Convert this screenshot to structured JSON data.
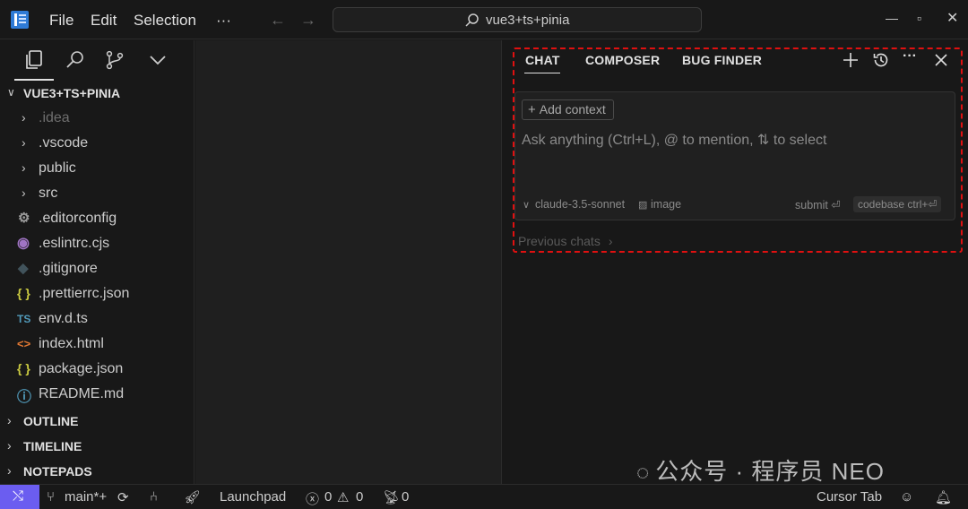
{
  "menu": {
    "file": "File",
    "edit": "Edit",
    "selection": "Selection",
    "more": "···"
  },
  "search": {
    "text": "vue3+ts+pinia"
  },
  "explorer": {
    "root": "VUE3+TS+PINIA",
    "items": [
      {
        "label": ".idea",
        "kind": "folder",
        "dim": true
      },
      {
        "label": ".vscode",
        "kind": "folder"
      },
      {
        "label": "public",
        "kind": "folder"
      },
      {
        "label": "src",
        "kind": "folder"
      },
      {
        "label": ".editorconfig",
        "kind": "gear-file"
      },
      {
        "label": ".eslintrc.cjs",
        "kind": "eslint-file"
      },
      {
        "label": ".gitignore",
        "kind": "git-file"
      },
      {
        "label": ".prettierrc.json",
        "kind": "json-file"
      },
      {
        "label": "env.d.ts",
        "kind": "ts-file"
      },
      {
        "label": "index.html",
        "kind": "html-file"
      },
      {
        "label": "package.json",
        "kind": "json-file"
      },
      {
        "label": "README.md",
        "kind": "info-file"
      }
    ],
    "sections": [
      "OUTLINE",
      "TIMELINE",
      "NOTEPADS"
    ]
  },
  "chat": {
    "tabs": [
      "CHAT",
      "COMPOSER",
      "BUG FINDER"
    ],
    "add_context": "Add context",
    "placeholder": "Ask anything (Ctrl+L), @ to mention, ⇅ to select",
    "model": "claude-3.5-sonnet",
    "image": "image",
    "submit": "submit ⏎",
    "codebase": "codebase  ctrl+⏎",
    "previous_chats": "Previous chats"
  },
  "icons": {
    "ts": "TS",
    "json": "{ }",
    "html": "<>"
  },
  "watermark": "公众号 · 程序员 NEO",
  "status": {
    "branch": "main*+",
    "launchpad": "Launchpad",
    "errors": "0",
    "warnings": "0",
    "ports": "0",
    "cursor_tab": "Cursor Tab"
  },
  "colors": {
    "accent": "#6b5df0",
    "highlight": "#e01010",
    "json_icon": "#cbcb41",
    "ts_icon": "#519aba",
    "html_icon": "#e37933"
  }
}
